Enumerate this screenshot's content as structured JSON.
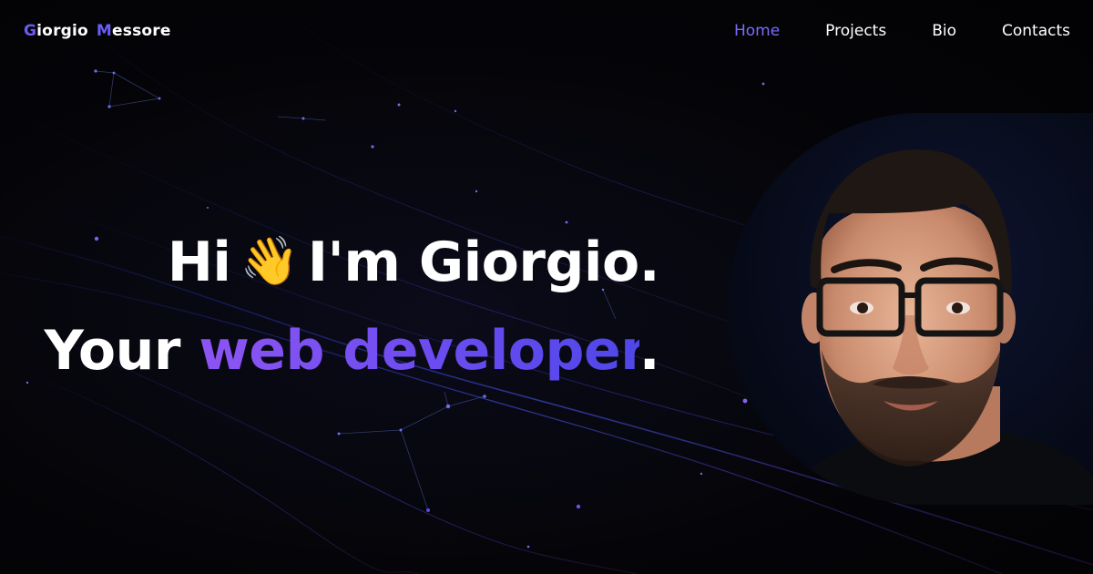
{
  "header": {
    "logo": {
      "first_initial": "G",
      "first_rest": "iorgio",
      "last_initial": "M",
      "last_rest": "essore"
    },
    "nav": [
      {
        "label": "Home",
        "active": true
      },
      {
        "label": "Projects",
        "active": false
      },
      {
        "label": "Bio",
        "active": false
      },
      {
        "label": "Contacts",
        "active": false
      }
    ]
  },
  "hero": {
    "line1_before": "Hi",
    "wave_emoji": "👋",
    "line1_after": "I'm Giorgio.",
    "line2_before": "Your",
    "line2_accent": "web developer",
    "line2_after": "."
  },
  "colors": {
    "background": "#030306",
    "accent_purple": "#8d55f2",
    "accent_blue": "#4f47e8",
    "nav_active": "#7a6cf8",
    "text": "#ffffff"
  }
}
